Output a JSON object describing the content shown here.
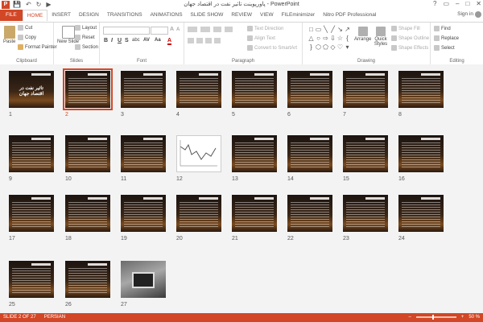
{
  "window": {
    "title": "پاورپوینت تاثیر نفت در اقتصاد جهان - PowerPoint",
    "sign_in": "Sign in",
    "app_logo": "P",
    "qat": {
      "save_icon": "💾",
      "undo_icon": "↶",
      "redo_icon": "↻",
      "present_icon": "▶"
    },
    "controls": {
      "help": "?",
      "ribbon": "▭",
      "minimize": "–",
      "maximize": "□",
      "close": "✕"
    }
  },
  "tabs": [
    "FILE",
    "HOME",
    "INSERT",
    "DESIGN",
    "TRANSITIONS",
    "ANIMATIONS",
    "SLIDE SHOW",
    "REVIEW",
    "VIEW",
    "FILEminimizer",
    "Nitro PDF Professional"
  ],
  "active_tab": "HOME",
  "ribbon": {
    "clipboard": {
      "label": "Clipboard",
      "paste": "Paste",
      "cut": "Cut",
      "copy": "Copy",
      "format_painter": "Format Painter"
    },
    "slides": {
      "label": "Slides",
      "new_slide": "New Slide",
      "layout": "Layout",
      "reset": "Reset",
      "section": "Section"
    },
    "font": {
      "label": "Font",
      "bold": "B",
      "italic": "I",
      "underline": "U",
      "strike": "S",
      "shadow": "abc",
      "spacing": "AV",
      "case": "Aa",
      "color": "A"
    },
    "paragraph": {
      "label": "Paragraph",
      "text_direction": "Text Direction",
      "align_text": "Align Text",
      "convert_smartart": "Convert to SmartArt"
    },
    "drawing": {
      "label": "Drawing",
      "arrange": "Arrange",
      "quick_styles": "Quick Styles",
      "shape_fill": "Shape Fill",
      "shape_outline": "Shape Outline",
      "shape_effects": "Shape Effects"
    },
    "editing": {
      "label": "Editing",
      "find": "Find",
      "replace": "Replace",
      "select": "Select"
    }
  },
  "slides": [
    {
      "num": "1",
      "kind": "title",
      "title": "تاثیر نفت در اقتصاد جهان"
    },
    {
      "num": "2",
      "kind": "text",
      "selected": true
    },
    {
      "num": "3",
      "kind": "text"
    },
    {
      "num": "4",
      "kind": "text"
    },
    {
      "num": "5",
      "kind": "text"
    },
    {
      "num": "6",
      "kind": "text"
    },
    {
      "num": "7",
      "kind": "text"
    },
    {
      "num": "8",
      "kind": "text"
    },
    {
      "num": "9",
      "kind": "text"
    },
    {
      "num": "10",
      "kind": "text"
    },
    {
      "num": "11",
      "kind": "text"
    },
    {
      "num": "12",
      "kind": "chart"
    },
    {
      "num": "13",
      "kind": "text"
    },
    {
      "num": "14",
      "kind": "text"
    },
    {
      "num": "15",
      "kind": "text"
    },
    {
      "num": "16",
      "kind": "text"
    },
    {
      "num": "17",
      "kind": "text"
    },
    {
      "num": "18",
      "kind": "text"
    },
    {
      "num": "19",
      "kind": "text"
    },
    {
      "num": "20",
      "kind": "text"
    },
    {
      "num": "21",
      "kind": "text"
    },
    {
      "num": "22",
      "kind": "text"
    },
    {
      "num": "23",
      "kind": "text"
    },
    {
      "num": "24",
      "kind": "text"
    },
    {
      "num": "25",
      "kind": "text"
    },
    {
      "num": "26",
      "kind": "text"
    },
    {
      "num": "27",
      "kind": "photo"
    }
  ],
  "status": {
    "slide_info": "SLIDE 2 OF 27",
    "language": "PERSIAN",
    "zoom": "50 %",
    "zoom_out": "–",
    "zoom_in": "+"
  },
  "colors": {
    "accent": "#d24726"
  }
}
